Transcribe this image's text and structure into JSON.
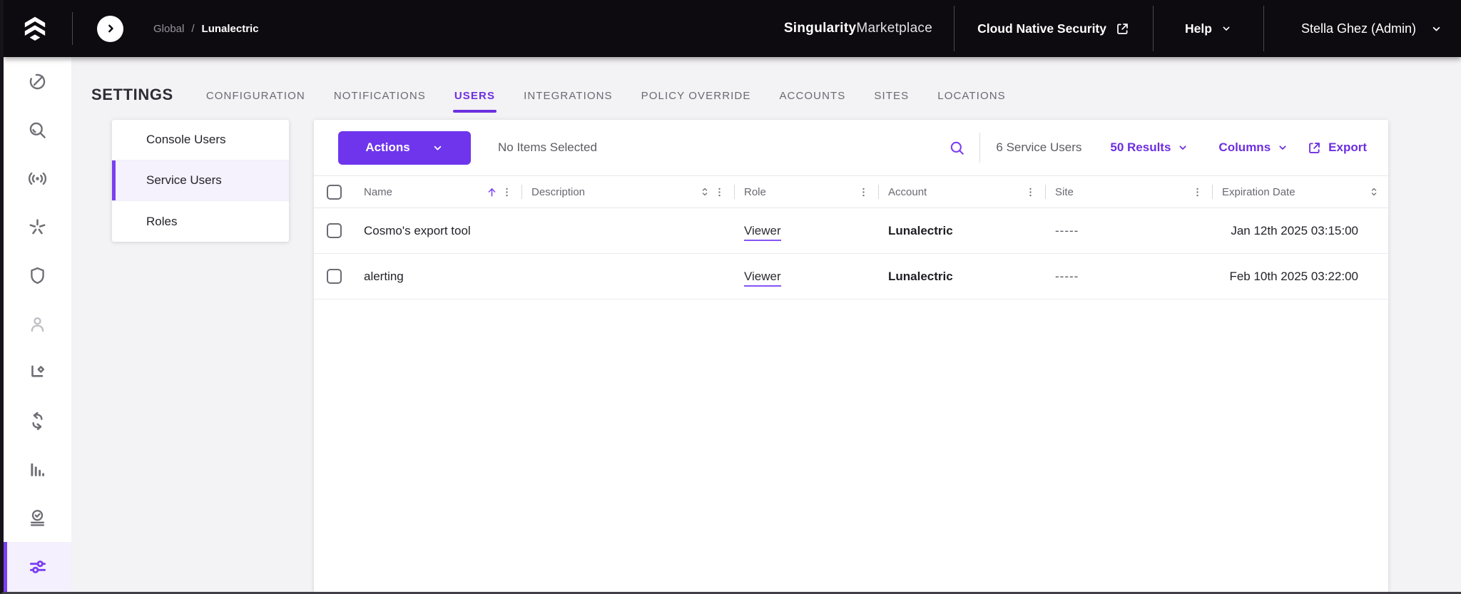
{
  "colors": {
    "accent": "#6D2FE0",
    "accent_bright": "#7B3FF2",
    "topbar_bg": "#0D0B0F",
    "page_bg": "#F3F2F4",
    "active_item_bg": "#F4F0FD",
    "link_underline": "#8455F6"
  },
  "topbar": {
    "breadcrumb": {
      "root": "Global",
      "separator": "/",
      "current": "Lunalectric"
    },
    "brand": {
      "primary": "Singularity",
      "secondary": "Marketplace"
    },
    "product_link": "Cloud Native Security",
    "help_label": "Help",
    "user_label": "Stella Ghez (Admin)"
  },
  "sidebar": {
    "items": [
      {
        "icon": "gauge-icon"
      },
      {
        "icon": "search-icon"
      },
      {
        "icon": "sensor-broadcast-icon"
      },
      {
        "icon": "star-burst-icon"
      },
      {
        "icon": "shield-icon"
      },
      {
        "icon": "user-icon"
      },
      {
        "icon": "tag-diamond-icon"
      },
      {
        "icon": "sync-arrows-icon"
      },
      {
        "icon": "bar-chart-icon"
      },
      {
        "icon": "scan-check-icon"
      },
      {
        "icon": "sliders-icon",
        "active": true
      }
    ]
  },
  "page": {
    "title": "SETTINGS",
    "tabs": [
      {
        "label": "CONFIGURATION",
        "active": false
      },
      {
        "label": "NOTIFICATIONS",
        "active": false
      },
      {
        "label": "USERS",
        "active": true
      },
      {
        "label": "INTEGRATIONS",
        "active": false
      },
      {
        "label": "POLICY OVERRIDE",
        "active": false
      },
      {
        "label": "ACCOUNTS",
        "active": false
      },
      {
        "label": "SITES",
        "active": false
      },
      {
        "label": "LOCATIONS",
        "active": false
      }
    ]
  },
  "subnav": {
    "items": [
      {
        "label": "Console Users",
        "active": false
      },
      {
        "label": "Service Users",
        "active": true
      },
      {
        "label": "Roles",
        "active": false
      }
    ]
  },
  "toolbar": {
    "actions_label": "Actions",
    "selection_status": "No Items Selected",
    "count_text": "6 Service Users",
    "results_text": "50 Results",
    "columns_label": "Columns",
    "export_label": "Export"
  },
  "table": {
    "headers": {
      "name": "Name",
      "description": "Description",
      "role": "Role",
      "account": "Account",
      "site": "Site",
      "expiration": "Expiration Date"
    },
    "rows": [
      {
        "name": "Cosmo's export tool",
        "description": "",
        "role": "Viewer",
        "account": "Lunalectric",
        "site": "-----",
        "expiration": "Jan 12th 2025 03:15:00"
      },
      {
        "name": "alerting",
        "description": "",
        "role": "Viewer",
        "account": "Lunalectric",
        "site": "-----",
        "expiration": "Feb 10th 2025 03:22:00"
      }
    ]
  }
}
